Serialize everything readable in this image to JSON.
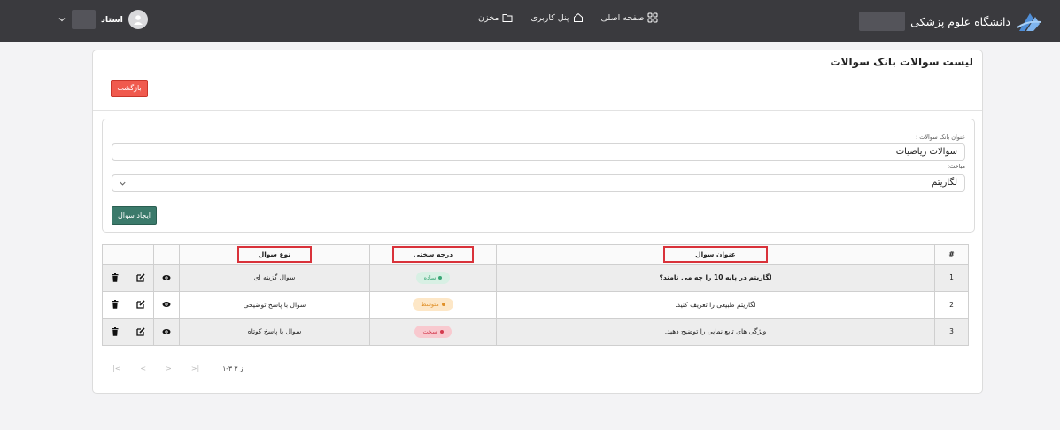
{
  "header": {
    "brand_name": "دانشگاه علوم پزشکی",
    "nav": [
      {
        "label": "صفحه اصلی",
        "icon": "grid-icon"
      },
      {
        "label": "پنل کاربری",
        "icon": "home-icon"
      },
      {
        "label": "مخزن",
        "icon": "folder-icon"
      }
    ],
    "user_name": "استاد"
  },
  "page": {
    "title": "لیست سوالات بانک سوالات",
    "back_label": "بازگشت"
  },
  "form": {
    "bank_title_label": "عنوان بانک سوالات :",
    "bank_title_value": "سوالات ریاضیات",
    "topics_label": "مباحث:",
    "topics_value": "لگاریتم",
    "create_label": "ایجاد سوال"
  },
  "table": {
    "headers": {
      "index": "#",
      "title": "عنوان سوال",
      "difficulty": "درجه سختی",
      "type": "نوع سوال"
    },
    "rows": [
      {
        "index": "1",
        "title": "لگاریتم در پایه 10 را چه می نامند؟",
        "difficulty": "ساده",
        "type": "سوال گزینه ای"
      },
      {
        "index": "2",
        "title": "لگاریتم طبیعی را تعریف کنید.",
        "difficulty": "متوسط",
        "type": "سوال با پاسخ توضیحی"
      },
      {
        "index": "3",
        "title": "ویژگی های تابع نمایی را توضیح دهید.",
        "difficulty": "سخت",
        "type": "سوال با پاسخ کوتاه"
      }
    ]
  },
  "pagination": {
    "first": "|<",
    "prev": "<",
    "next": ">",
    "last": ">|",
    "info": "۱-۳ از ۳"
  },
  "colors": {
    "topbar": "#3a3a3e",
    "back_button": "#f05a4e",
    "create_button": "#3b7a6b",
    "highlight": "#d9323a",
    "easy_bg": "#d8f0e4",
    "easy_fg": "#3aa776",
    "medium_bg": "#fde7c7",
    "medium_fg": "#e0912a",
    "hard_bg": "#f8c9cf",
    "hard_fg": "#d33b4e"
  }
}
